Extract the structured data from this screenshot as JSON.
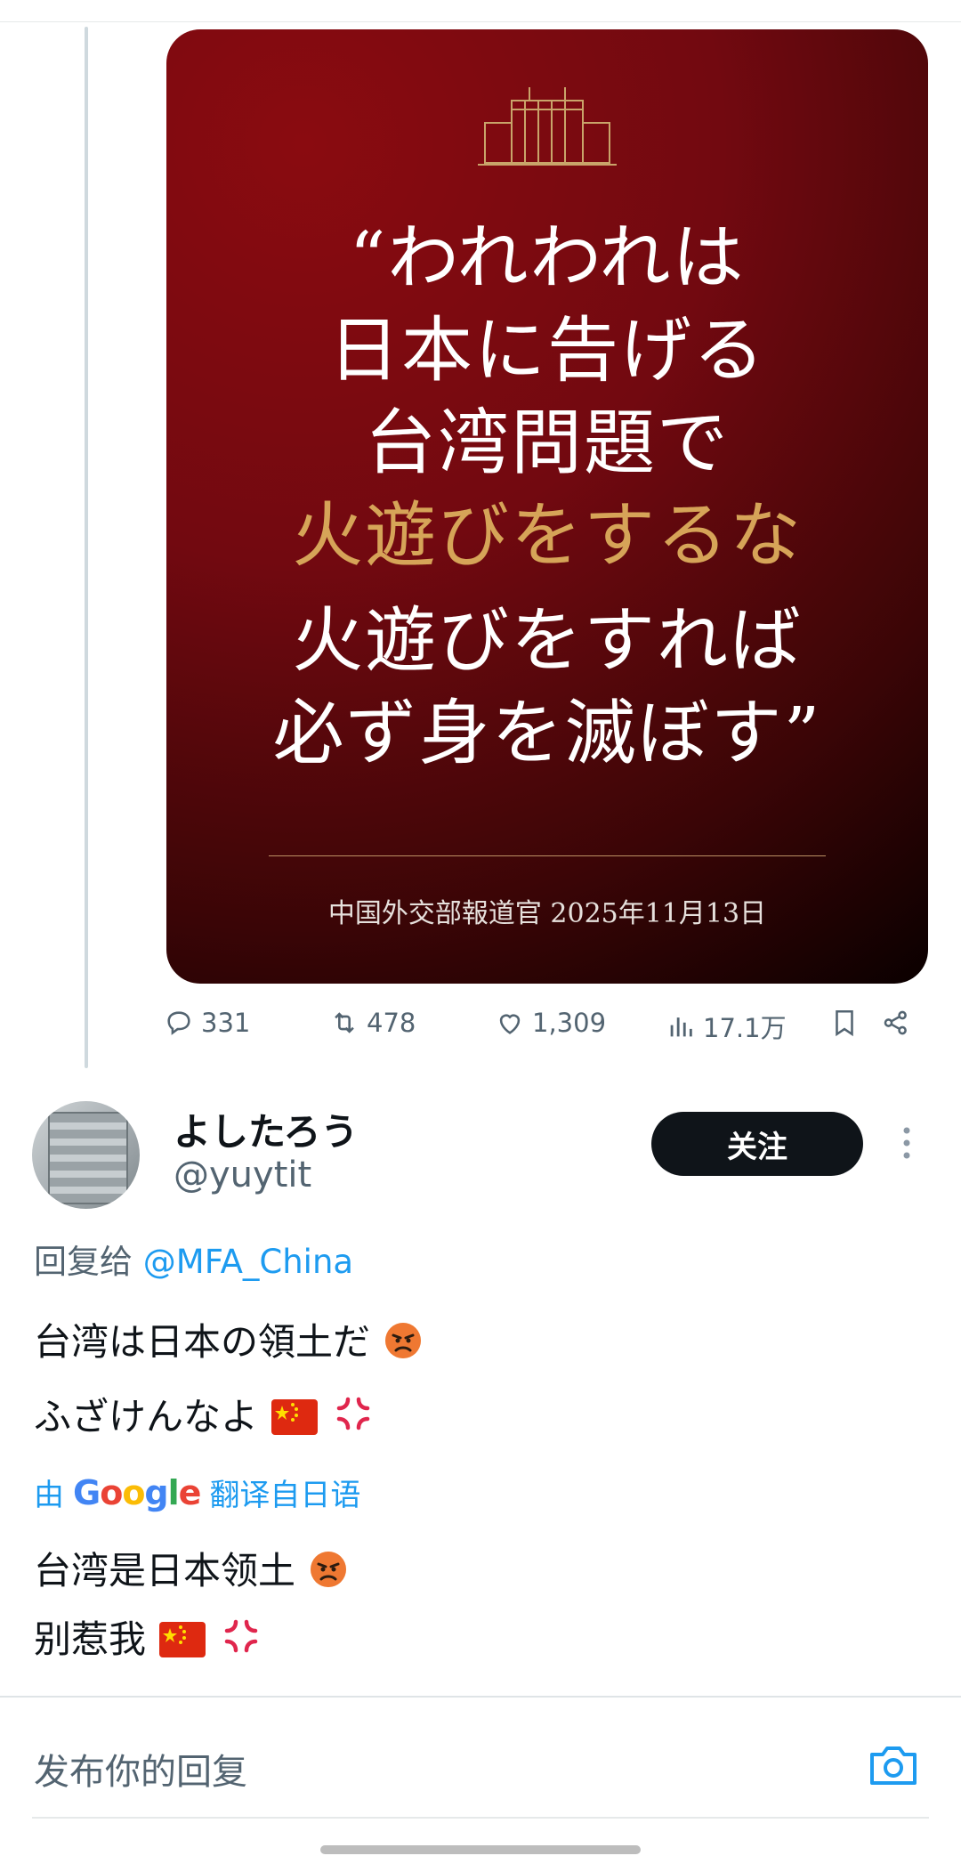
{
  "card": {
    "quote_lines": [
      {
        "text": "“われわれは",
        "gold": false
      },
      {
        "text": "日本に告げる",
        "gold": false
      },
      {
        "text": "台湾問題で",
        "gold": false
      },
      {
        "text": "火遊びをするな",
        "gold": true
      },
      {
        "text": "火遊びをすれば",
        "gold": false
      },
      {
        "text": "必ず身を滅ぼす”",
        "gold": false
      }
    ],
    "attribution": "中国外交部報道官  2025年11月13日"
  },
  "metrics": {
    "replies": "331",
    "retweets": "478",
    "likes": "1,309",
    "views": "17.1万"
  },
  "reply": {
    "name": "よしたろう",
    "handle": "@yuytit",
    "follow_label": "关注",
    "reply_to_label": "回复给",
    "mention": "@MFA_China",
    "text_line1": "台湾は日本の領土だ",
    "text_line2": "ふざけんなよ",
    "translated_prefix": "由",
    "translated_suffix": "翻译自日语",
    "translation_line1": "台湾是日本领土",
    "translation_line2": "别惹我"
  },
  "composer": {
    "placeholder": "发布你的回复"
  },
  "icons": {
    "reply": "comment-icon",
    "retweet": "retweet-icon",
    "like": "heart-icon",
    "views": "views-icon",
    "bookmark": "bookmark-icon",
    "share": "share-icon",
    "camera": "camera-icon"
  },
  "colors": {
    "accent": "#1d9bf0",
    "card_red": "#720910",
    "gold": "#d6a458"
  }
}
